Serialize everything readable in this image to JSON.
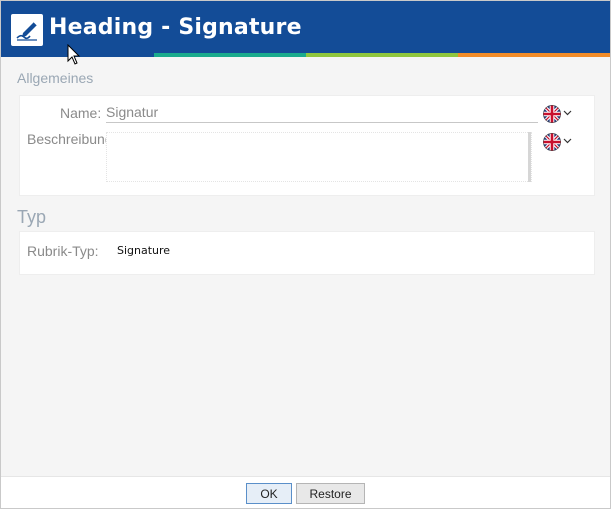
{
  "window": {
    "title": "Heading - Signature"
  },
  "general_section": {
    "heading": "Allgemeines",
    "name_label": "Name:",
    "name_value": "Signatur",
    "description_label": "Beschreibung:",
    "description_value": "",
    "language": "English (UK flag)"
  },
  "type_section": {
    "heading": "Typ",
    "rubric_type_label": "Rubrik-Typ:",
    "rubric_type_value": "Signature"
  },
  "buttons": {
    "ok": "OK",
    "restore": "Restore"
  },
  "colors": {
    "titlebar": "#134c97",
    "stripe": [
      "#134c97",
      "#1aab8d",
      "#8fc63e",
      "#f28c28"
    ],
    "section_heading": "#9aa7b4",
    "ok_border": "#5a8fc9"
  },
  "icons": {
    "app": "signature-pen-icon",
    "language": "uk-flag-icon",
    "dropdown": "chevron-down-icon"
  }
}
